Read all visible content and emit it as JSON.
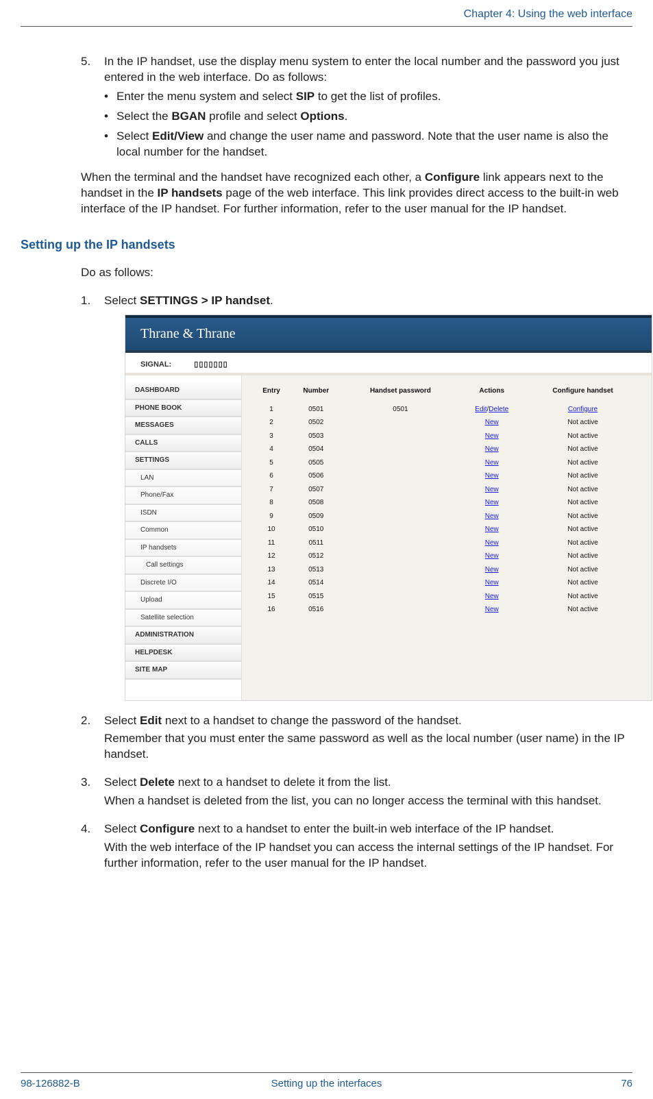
{
  "header": {
    "chapter": "Chapter 4: Using the web interface"
  },
  "step5": {
    "num": "5.",
    "text_a": "In the IP handset, use the display menu system to enter the local number and the password you just entered in the web interface. Do as follows:",
    "b1_pre": "Enter the menu system and select ",
    "b1_bold": "SIP",
    "b1_post": " to get the list of profiles.",
    "b2_pre": "Select the ",
    "b2_bold1": "BGAN",
    "b2_mid": " profile and select ",
    "b2_bold2": "Options",
    "b2_post": ".",
    "b3_pre": "Select ",
    "b3_bold": "Edit/View",
    "b3_post": " and change the user name and password. Note that the user name is also the local number for the handset."
  },
  "para_after5": {
    "pre": "When the terminal and the handset have recognized each other, a ",
    "bold1": "Configure",
    "mid1": " link appears next to the handset in the ",
    "bold2": "IP handsets",
    "post": " page of the web interface. This link provides direct access to the built-in web interface of the IP handset. For further information, refer to the user manual for the IP handset."
  },
  "section_heading": "Setting up the IP handsets",
  "intro": "Do as follows:",
  "step1": {
    "num": "1.",
    "pre": "Select ",
    "bold": "SETTINGS > IP handset",
    "post": "."
  },
  "figure": {
    "brand": "Thrane & Thrane",
    "signal_label": "SIGNAL:",
    "signal_bars": "▯▯▯▯▯▯▯",
    "nav": [
      "DASHBOARD",
      "PHONE BOOK",
      "MESSAGES",
      "CALLS",
      "SETTINGS"
    ],
    "nav_sub": [
      "LAN",
      "Phone/Fax",
      "ISDN",
      "Common",
      "IP handsets"
    ],
    "nav_sub2": [
      "Call settings"
    ],
    "nav_sub_after": [
      "Discrete I/O",
      "Upload",
      "Satellite selection"
    ],
    "nav_after": [
      "ADMINISTRATION",
      "HELPDESK",
      "SITE MAP"
    ],
    "columns": [
      "Entry",
      "Number",
      "Handset password",
      "Actions",
      "Configure handset"
    ],
    "rows": [
      {
        "entry": "1",
        "number": "0501",
        "pwd": "0501",
        "action": "Edit/Delete",
        "configure": "Configure"
      },
      {
        "entry": "2",
        "number": "0502",
        "pwd": "",
        "action": "New",
        "configure": "Not active"
      },
      {
        "entry": "3",
        "number": "0503",
        "pwd": "",
        "action": "New",
        "configure": "Not active"
      },
      {
        "entry": "4",
        "number": "0504",
        "pwd": "",
        "action": "New",
        "configure": "Not active"
      },
      {
        "entry": "5",
        "number": "0505",
        "pwd": "",
        "action": "New",
        "configure": "Not active"
      },
      {
        "entry": "6",
        "number": "0506",
        "pwd": "",
        "action": "New",
        "configure": "Not active"
      },
      {
        "entry": "7",
        "number": "0507",
        "pwd": "",
        "action": "New",
        "configure": "Not active"
      },
      {
        "entry": "8",
        "number": "0508",
        "pwd": "",
        "action": "New",
        "configure": "Not active"
      },
      {
        "entry": "9",
        "number": "0509",
        "pwd": "",
        "action": "New",
        "configure": "Not active"
      },
      {
        "entry": "10",
        "number": "0510",
        "pwd": "",
        "action": "New",
        "configure": "Not active"
      },
      {
        "entry": "11",
        "number": "0511",
        "pwd": "",
        "action": "New",
        "configure": "Not active"
      },
      {
        "entry": "12",
        "number": "0512",
        "pwd": "",
        "action": "New",
        "configure": "Not active"
      },
      {
        "entry": "13",
        "number": "0513",
        "pwd": "",
        "action": "New",
        "configure": "Not active"
      },
      {
        "entry": "14",
        "number": "0514",
        "pwd": "",
        "action": "New",
        "configure": "Not active"
      },
      {
        "entry": "15",
        "number": "0515",
        "pwd": "",
        "action": "New",
        "configure": "Not active"
      },
      {
        "entry": "16",
        "number": "0516",
        "pwd": "",
        "action": "New",
        "configure": "Not active"
      }
    ]
  },
  "step2": {
    "num": "2.",
    "pre": "Select ",
    "bold": "Edit",
    "post": " next to a handset to change the password of the handset.",
    "follow": "Remember that you must enter the same password as well as the local number (user name) in the IP handset."
  },
  "step3": {
    "num": "3.",
    "pre": "Select ",
    "bold": "Delete",
    "post": " next to a handset to delete it from the list.",
    "follow": "When a handset is deleted from the list, you can no longer access the terminal with this handset."
  },
  "step4": {
    "num": "4.",
    "pre": "Select ",
    "bold": "Configure",
    "post": " next to a handset to enter the built-in web interface of the IP handset.",
    "follow": "With the web interface of the IP handset you can access the internal settings of the IP handset. For further information, refer to the user manual for the IP handset."
  },
  "footer": {
    "left": "98-126882-B",
    "center": "Setting up the interfaces",
    "right": "76"
  }
}
